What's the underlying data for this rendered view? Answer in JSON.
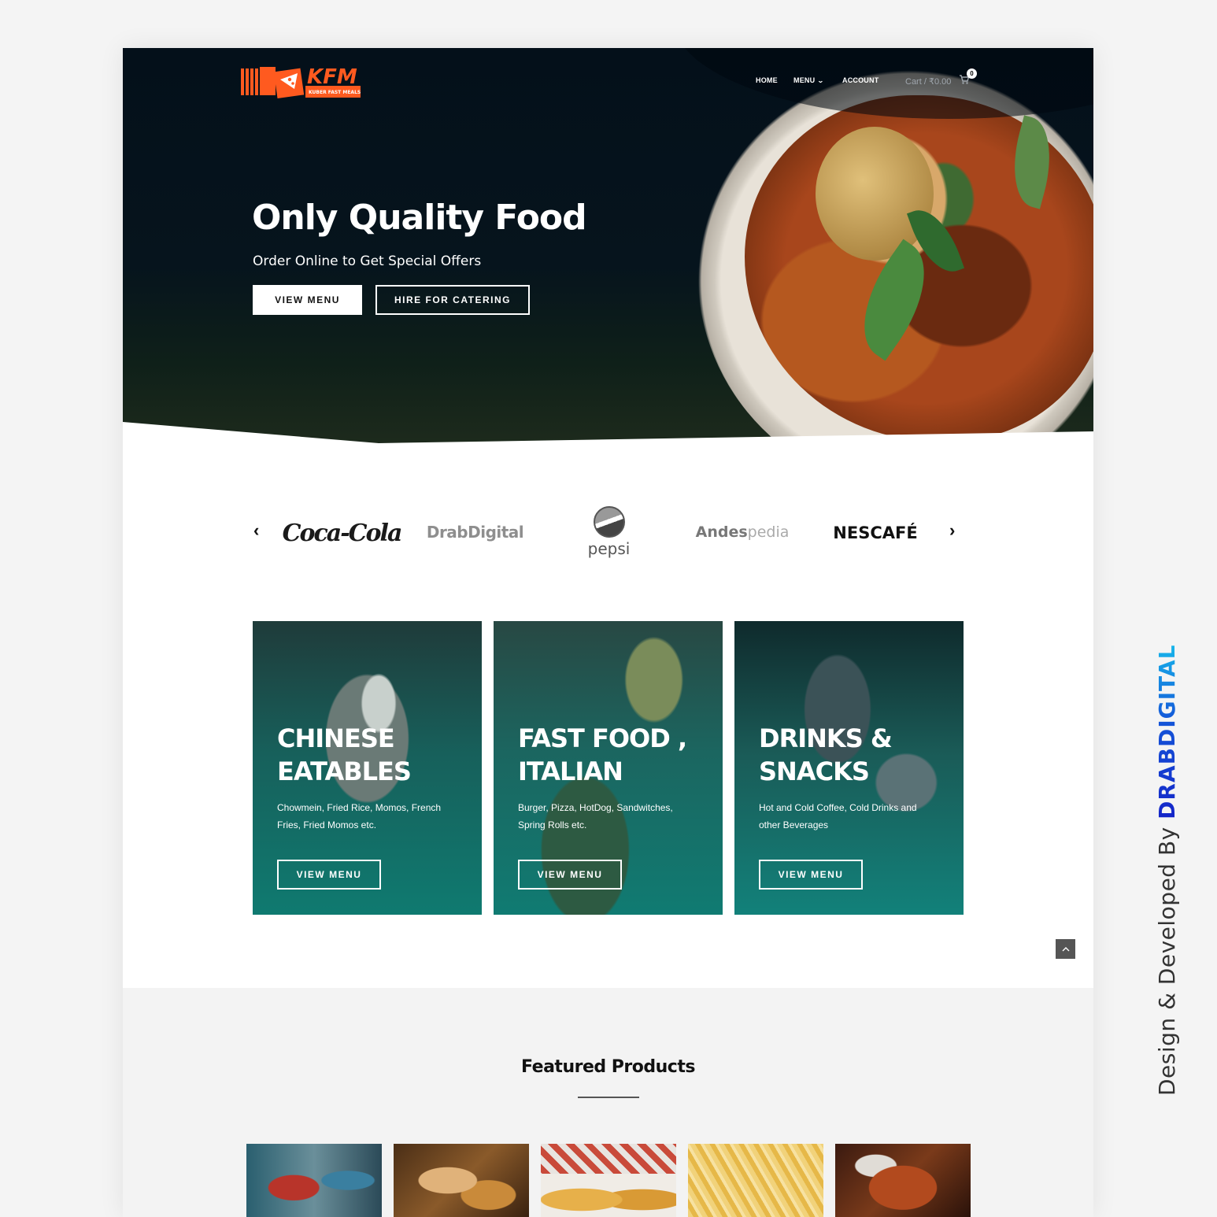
{
  "brand": {
    "logo_text": "KFM",
    "logo_tagline": "KUBER FAST MEALS",
    "logo_color": "#ff5a1f"
  },
  "nav": {
    "items": [
      {
        "label": "HOME"
      },
      {
        "label": "MENU"
      },
      {
        "label": "ACCOUNT"
      }
    ],
    "cart_label": "Cart / ₹0.00",
    "cart_count": "0"
  },
  "hero": {
    "title": "Only Quality Food",
    "subtitle": "Order Online to Get Special Offers",
    "primary_button": "VIEW MENU",
    "secondary_button": "HIRE FOR CATERING"
  },
  "brands": {
    "prev_icon": "chevron-left-icon",
    "next_icon": "chevron-right-icon",
    "items": [
      {
        "name": "Coca-Cola"
      },
      {
        "name": "DrabDigital"
      },
      {
        "name": "pepsi"
      },
      {
        "name": "Andes",
        "suffix": "pedia"
      },
      {
        "name": "NESCAFÉ"
      }
    ]
  },
  "categories": [
    {
      "title_line1": "CHINESE",
      "title_line2": "EATABLES",
      "description": "Chowmein, Fried Rice, Momos, French Fries,  Fried Momos etc.",
      "button": "VIEW MENU"
    },
    {
      "title_line1": "FAST FOOD ,",
      "title_line2": "ITALIAN",
      "description": "Burger, Pizza, HotDog, Sandwitches, Spring Rolls etc.",
      "button": "VIEW MENU"
    },
    {
      "title_line1": "DRINKS &",
      "title_line2": "SNACKS",
      "description": "Hot and Cold Coffee, Cold Drinks and other Beverages",
      "button": "VIEW MENU"
    }
  ],
  "back_to_top_icon": "chevron-up-icon",
  "featured": {
    "title": "Featured Products"
  },
  "credit": {
    "prefix": "Design & Developed By ",
    "name": "DRABDIGITAL"
  },
  "colors": {
    "hero_bg": "#04101a",
    "card_teal": "#0f7a70",
    "accent_orange": "#ff5a1f",
    "credit_blue": "#1424c8",
    "credit_cyan": "#17b6ea"
  }
}
